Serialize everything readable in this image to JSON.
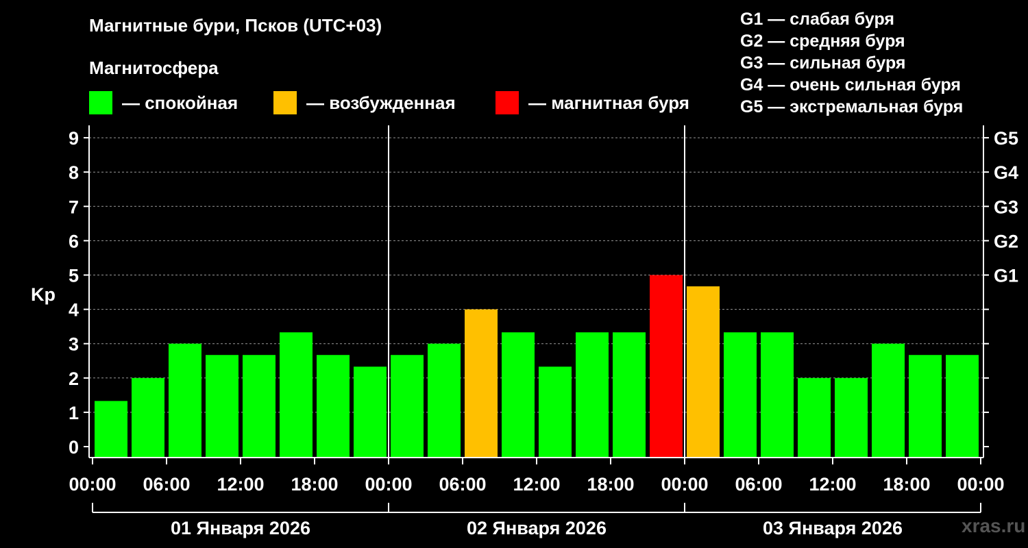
{
  "header": {
    "title": "Магнитные бури, Псков (UTC+03)",
    "subtitle": "Магнитосфера"
  },
  "legend": [
    {
      "label": "— спокойная",
      "color": "#00ff00"
    },
    {
      "label": "— возбужденная",
      "color": "#ffc000"
    },
    {
      "label": "— магнитная буря",
      "color": "#ff0000"
    }
  ],
  "g_levels": [
    "G1 — слабая буря",
    "G2 — средняя буря",
    "G3 — сильная буря",
    "G4 — очень сильная буря",
    "G5 — экстремальная буря"
  ],
  "watermark": "xras.ru",
  "chart_data": {
    "type": "bar",
    "ylabel": "Kp",
    "ylim": [
      0,
      9
    ],
    "y_ticks": [
      "0",
      "1",
      "2",
      "3",
      "4",
      "5",
      "6",
      "7",
      "8",
      "9"
    ],
    "right_ticks": [
      {
        "value": 5,
        "label": "G1"
      },
      {
        "value": 6,
        "label": "G2"
      },
      {
        "value": 7,
        "label": "G3"
      },
      {
        "value": 8,
        "label": "G4"
      },
      {
        "value": 9,
        "label": "G5"
      }
    ],
    "x_tick_labels": [
      "00:00",
      "06:00",
      "12:00",
      "18:00",
      "00:00",
      "06:00",
      "12:00",
      "18:00",
      "00:00",
      "06:00",
      "12:00",
      "18:00",
      "00:00"
    ],
    "days": [
      "01 Января 2026",
      "02 Января 2026",
      "03 Января 2026"
    ],
    "grid": true,
    "values": [
      1.33,
      2.0,
      3.0,
      2.67,
      2.67,
      3.33,
      2.67,
      2.33,
      2.67,
      3.0,
      4.0,
      3.33,
      2.33,
      3.33,
      3.33,
      5.0,
      4.67,
      3.33,
      3.33,
      2.0,
      2.0,
      3.0,
      2.67,
      2.67
    ],
    "colors": {
      "quiet": "#00ff00",
      "active": "#ffc000",
      "storm": "#ff0000"
    }
  }
}
